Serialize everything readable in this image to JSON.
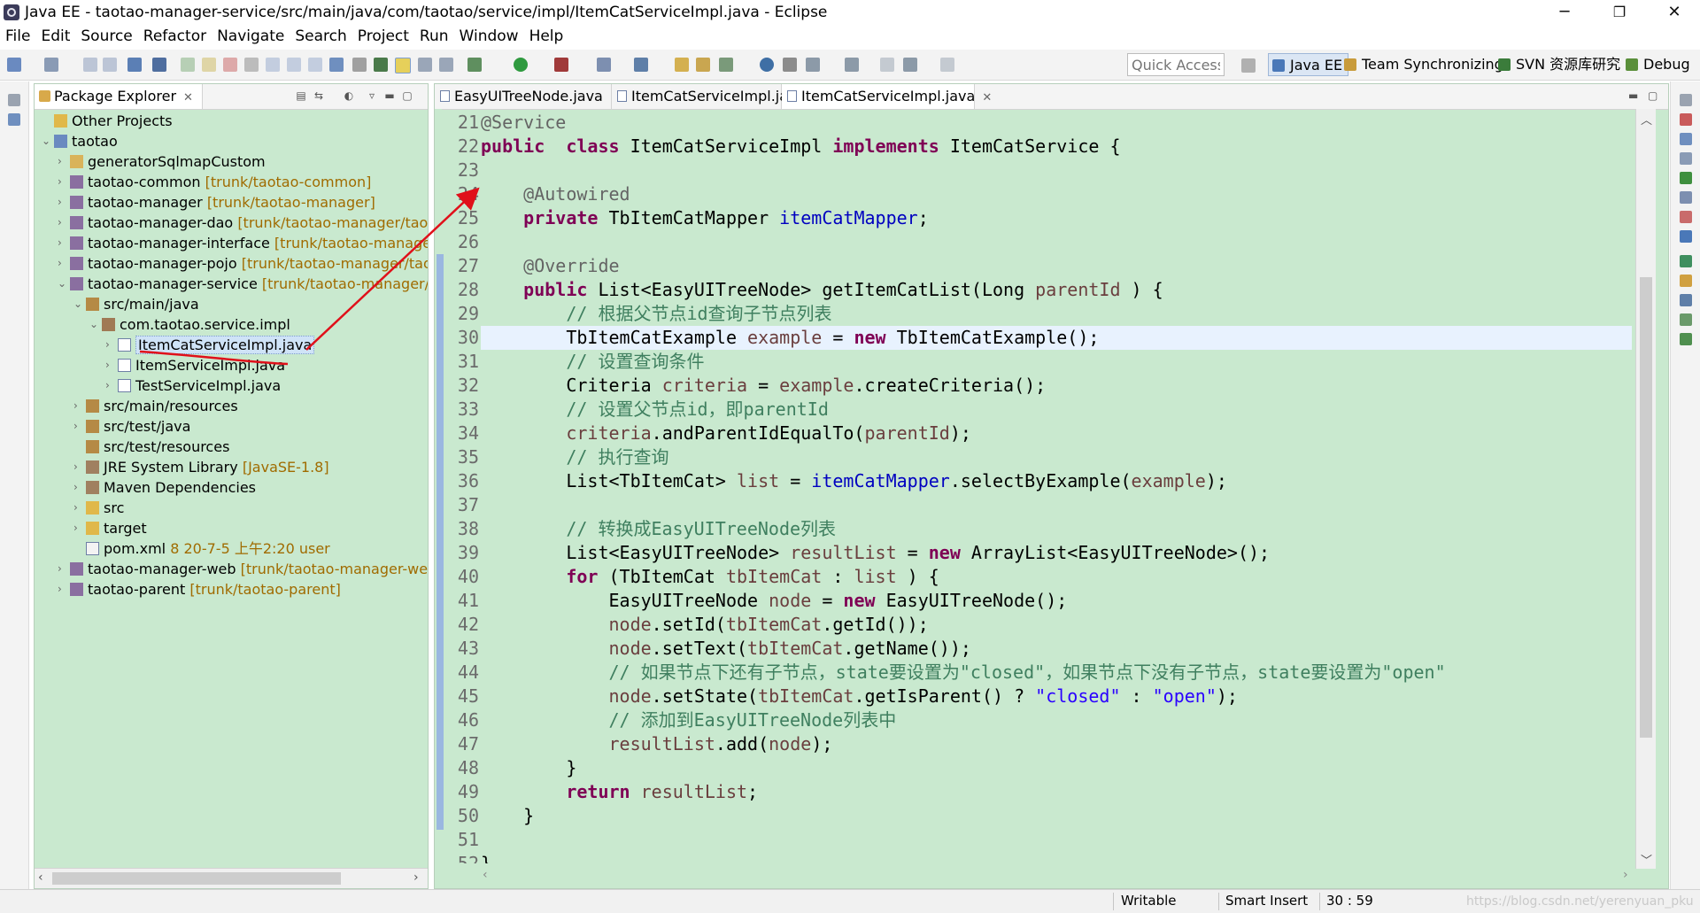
{
  "window": {
    "title": "Java EE - taotao-manager-service/src/main/java/com/taotao/service/impl/ItemCatServiceImpl.java - Eclipse",
    "minimize": "─",
    "restore": "❐",
    "close": "✕"
  },
  "menu": [
    "File",
    "Edit",
    "Source",
    "Refactor",
    "Navigate",
    "Search",
    "Project",
    "Run",
    "Window",
    "Help"
  ],
  "toolbar": {
    "quick_access_placeholder": "Quick Access",
    "perspectives": [
      {
        "label": "Java EE",
        "active": true,
        "color": "#4a78b8"
      },
      {
        "label": "Team Synchronizing",
        "active": false,
        "color": "#c89b3b"
      },
      {
        "label": "SVN 资源库研究",
        "active": false,
        "color": "#3b7c3b"
      },
      {
        "label": "Debug",
        "active": false,
        "color": "#5a8f3a"
      }
    ]
  },
  "package_explorer": {
    "title": "Package Explorer",
    "close": "✕",
    "tree": [
      {
        "depth": 0,
        "twisty": "",
        "icon": "folder-icon",
        "label": "Other Projects",
        "decoration": ""
      },
      {
        "depth": 0,
        "twisty": "⌄",
        "icon": "working-set-icon",
        "label": "taotao",
        "decoration": ""
      },
      {
        "depth": 1,
        "twisty": "›",
        "icon": "project-icon",
        "label": "generatorSqlmapCustom",
        "decoration": ""
      },
      {
        "depth": 1,
        "twisty": "›",
        "icon": "maven-project-icon",
        "label": "taotao-common",
        "decoration": "[trunk/taotao-common]"
      },
      {
        "depth": 1,
        "twisty": "›",
        "icon": "maven-project-icon",
        "label": "taotao-manager",
        "decoration": "[trunk/taotao-manager]"
      },
      {
        "depth": 1,
        "twisty": "›",
        "icon": "maven-project-icon",
        "label": "taotao-manager-dao",
        "decoration": "[trunk/taotao-manager/taotao-"
      },
      {
        "depth": 1,
        "twisty": "›",
        "icon": "maven-project-icon",
        "label": "taotao-manager-interface",
        "decoration": "[trunk/taotao-manager/ta"
      },
      {
        "depth": 1,
        "twisty": "›",
        "icon": "maven-project-icon",
        "label": "taotao-manager-pojo",
        "decoration": "[trunk/taotao-manager/taotao"
      },
      {
        "depth": 1,
        "twisty": "⌄",
        "icon": "maven-project-icon",
        "label": "taotao-manager-service",
        "decoration": "[trunk/taotao-manager/taot"
      },
      {
        "depth": 2,
        "twisty": "⌄",
        "icon": "source-folder-icon",
        "label": "src/main/java",
        "decoration": ""
      },
      {
        "depth": 3,
        "twisty": "⌄",
        "icon": "package-icon",
        "label": "com.taotao.service.impl",
        "decoration": ""
      },
      {
        "depth": 4,
        "twisty": "›",
        "icon": "java-file-icon",
        "label": "ItemCatServiceImpl.java",
        "decoration": "",
        "selected": true
      },
      {
        "depth": 4,
        "twisty": "›",
        "icon": "java-file-icon",
        "label": "ItemServiceImpl.java",
        "decoration": ""
      },
      {
        "depth": 4,
        "twisty": "›",
        "icon": "java-file-icon",
        "label": "TestServiceImpl.java",
        "decoration": ""
      },
      {
        "depth": 2,
        "twisty": "›",
        "icon": "source-folder-icon",
        "label": "src/main/resources",
        "decoration": ""
      },
      {
        "depth": 2,
        "twisty": "›",
        "icon": "source-folder-icon",
        "label": "src/test/java",
        "decoration": ""
      },
      {
        "depth": 2,
        "twisty": "",
        "icon": "source-folder-icon",
        "label": "src/test/resources",
        "decoration": ""
      },
      {
        "depth": 2,
        "twisty": "›",
        "icon": "library-icon",
        "label": "JRE System Library",
        "decoration": "[JavaSE-1.8]"
      },
      {
        "depth": 2,
        "twisty": "›",
        "icon": "library-icon",
        "label": "Maven Dependencies",
        "decoration": ""
      },
      {
        "depth": 2,
        "twisty": "›",
        "icon": "folder-icon",
        "label": "src",
        "decoration": ""
      },
      {
        "depth": 2,
        "twisty": "›",
        "icon": "folder-icon",
        "label": "target",
        "decoration": ""
      },
      {
        "depth": 2,
        "twisty": "",
        "icon": "xml-file-icon",
        "label": "pom.xml",
        "decoration": "8  20-7-5 上午2:20  user"
      },
      {
        "depth": 1,
        "twisty": "›",
        "icon": "maven-project-icon",
        "label": "taotao-manager-web",
        "decoration": "[trunk/taotao-manager-web]"
      },
      {
        "depth": 1,
        "twisty": "›",
        "icon": "maven-project-icon",
        "label": "taotao-parent",
        "decoration": "[trunk/taotao-parent]"
      }
    ]
  },
  "editor": {
    "tabs": [
      {
        "label": "EasyUITreeNode.java",
        "active": false
      },
      {
        "label": "ItemCatServiceImpl.java",
        "active": false
      },
      {
        "label": "ItemCatServiceImpl.java",
        "active": true
      }
    ],
    "first_line_number": 21,
    "current_line": 30,
    "lines": [
      {
        "n": "21",
        "t": [
          [
            "an",
            "@Service"
          ]
        ]
      },
      {
        "n": "22",
        "t": [
          [
            "kw",
            "public"
          ],
          [
            "",
            "  "
          ],
          [
            "kw",
            "class"
          ],
          [
            "",
            " ItemCatServiceImpl "
          ],
          [
            "kw",
            "implements"
          ],
          [
            "",
            " ItemCatService {"
          ]
        ]
      },
      {
        "n": "23",
        "t": [
          [
            "",
            ""
          ]
        ]
      },
      {
        "n": "24",
        "t": [
          [
            "",
            "    "
          ],
          [
            "an",
            "@Autowired"
          ]
        ]
      },
      {
        "n": "25",
        "t": [
          [
            "",
            "    "
          ],
          [
            "kw",
            "private"
          ],
          [
            "",
            " TbItemCatMapper "
          ],
          [
            "fd",
            "itemCatMapper"
          ],
          [
            "",
            ";"
          ]
        ]
      },
      {
        "n": "26",
        "t": [
          [
            "",
            ""
          ]
        ]
      },
      {
        "n": "27",
        "t": [
          [
            "",
            "    "
          ],
          [
            "an",
            "@Override"
          ]
        ]
      },
      {
        "n": "28",
        "t": [
          [
            "",
            "    "
          ],
          [
            "kw",
            "public"
          ],
          [
            "",
            " List<EasyUITreeNode> getItemCatList(Long "
          ],
          [
            "lv",
            "parentId"
          ],
          [
            "",
            " ) {"
          ]
        ]
      },
      {
        "n": "29",
        "t": [
          [
            "",
            "        "
          ],
          [
            "cm",
            "// 根据父节点id查询子节点列表"
          ]
        ]
      },
      {
        "n": "30",
        "t": [
          [
            "",
            "        TbItemCatExample "
          ],
          [
            "lv",
            "example"
          ],
          [
            "",
            " = "
          ],
          [
            "kw",
            "new"
          ],
          [
            "",
            " TbItemCatExample();"
          ]
        ]
      },
      {
        "n": "31",
        "t": [
          [
            "",
            "        "
          ],
          [
            "cm",
            "// 设置查询条件"
          ]
        ]
      },
      {
        "n": "32",
        "t": [
          [
            "",
            "        Criteria "
          ],
          [
            "lv",
            "criteria"
          ],
          [
            "",
            " = "
          ],
          [
            "lv",
            "example"
          ],
          [
            "",
            ".createCriteria();"
          ]
        ]
      },
      {
        "n": "33",
        "t": [
          [
            "",
            "        "
          ],
          [
            "cm",
            "// 设置父节点id，即parentId"
          ]
        ]
      },
      {
        "n": "34",
        "t": [
          [
            "",
            "        "
          ],
          [
            "lv",
            "criteria"
          ],
          [
            "",
            ".andParentIdEqualTo("
          ],
          [
            "lv",
            "parentId"
          ],
          [
            "",
            ");"
          ]
        ]
      },
      {
        "n": "35",
        "t": [
          [
            "",
            "        "
          ],
          [
            "cm",
            "// 执行查询"
          ]
        ]
      },
      {
        "n": "36",
        "t": [
          [
            "",
            "        List<TbItemCat> "
          ],
          [
            "lv",
            "list"
          ],
          [
            "",
            " = "
          ],
          [
            "fd",
            "itemCatMapper"
          ],
          [
            "",
            ".selectByExample("
          ],
          [
            "lv",
            "example"
          ],
          [
            "",
            ");"
          ]
        ]
      },
      {
        "n": "37",
        "t": [
          [
            "",
            ""
          ]
        ]
      },
      {
        "n": "38",
        "t": [
          [
            "",
            "        "
          ],
          [
            "cm",
            "// 转换成EasyUITreeNode列表"
          ]
        ]
      },
      {
        "n": "39",
        "t": [
          [
            "",
            "        List<EasyUITreeNode> "
          ],
          [
            "lv",
            "resultList"
          ],
          [
            "",
            " = "
          ],
          [
            "kw",
            "new"
          ],
          [
            "",
            " ArrayList<EasyUITreeNode>();"
          ]
        ]
      },
      {
        "n": "40",
        "t": [
          [
            "",
            "        "
          ],
          [
            "kw",
            "for"
          ],
          [
            "",
            " (TbItemCat "
          ],
          [
            "lv",
            "tbItemCat"
          ],
          [
            "",
            " : "
          ],
          [
            "lv",
            "list"
          ],
          [
            "",
            " ) {"
          ]
        ]
      },
      {
        "n": "41",
        "t": [
          [
            "",
            "            EasyUITreeNode "
          ],
          [
            "lv",
            "node"
          ],
          [
            "",
            " = "
          ],
          [
            "kw",
            "new"
          ],
          [
            "",
            " EasyUITreeNode();"
          ]
        ]
      },
      {
        "n": "42",
        "t": [
          [
            "",
            "            "
          ],
          [
            "lv",
            "node"
          ],
          [
            "",
            ".setId("
          ],
          [
            "lv",
            "tbItemCat"
          ],
          [
            "",
            ".getId());"
          ]
        ]
      },
      {
        "n": "43",
        "t": [
          [
            "",
            "            "
          ],
          [
            "lv",
            "node"
          ],
          [
            "",
            ".setText("
          ],
          [
            "lv",
            "tbItemCat"
          ],
          [
            "",
            ".getName());"
          ]
        ]
      },
      {
        "n": "44",
        "t": [
          [
            "",
            "            "
          ],
          [
            "cm",
            "// 如果节点下还有子节点，state要设置为\"closed\"，如果节点下没有子节点，state要设置为\"open\""
          ]
        ]
      },
      {
        "n": "45",
        "t": [
          [
            "",
            "            "
          ],
          [
            "lv",
            "node"
          ],
          [
            "",
            ".setState("
          ],
          [
            "lv",
            "tbItemCat"
          ],
          [
            "",
            ".getIsParent() ? "
          ],
          [
            "st",
            "\"closed\""
          ],
          [
            "",
            " : "
          ],
          [
            "st",
            "\"open\""
          ],
          [
            "",
            ");"
          ]
        ]
      },
      {
        "n": "46",
        "t": [
          [
            "",
            "            "
          ],
          [
            "cm",
            "// 添加到EasyUITreeNode列表中"
          ]
        ]
      },
      {
        "n": "47",
        "t": [
          [
            "",
            "            "
          ],
          [
            "lv",
            "resultList"
          ],
          [
            "",
            ".add("
          ],
          [
            "lv",
            "node"
          ],
          [
            "",
            ");"
          ]
        ]
      },
      {
        "n": "48",
        "t": [
          [
            "",
            "        }"
          ]
        ]
      },
      {
        "n": "49",
        "t": [
          [
            "",
            "        "
          ],
          [
            "kw",
            "return"
          ],
          [
            "",
            " "
          ],
          [
            "lv",
            "resultList"
          ],
          [
            "",
            ";"
          ]
        ]
      },
      {
        "n": "50",
        "t": [
          [
            "",
            "    }"
          ]
        ]
      },
      {
        "n": "51",
        "t": [
          [
            "",
            ""
          ]
        ]
      },
      {
        "n": "52",
        "t": [
          [
            "",
            "}"
          ]
        ]
      }
    ]
  },
  "status": {
    "writable": "Writable",
    "insert_mode": "Smart Insert",
    "position": "30 : 59",
    "watermark": "https://blog.csdn.net/yerenyuan_pku"
  },
  "colors": {
    "editor_background": "#c9e9cf",
    "annotation_red": "#e0101a"
  }
}
